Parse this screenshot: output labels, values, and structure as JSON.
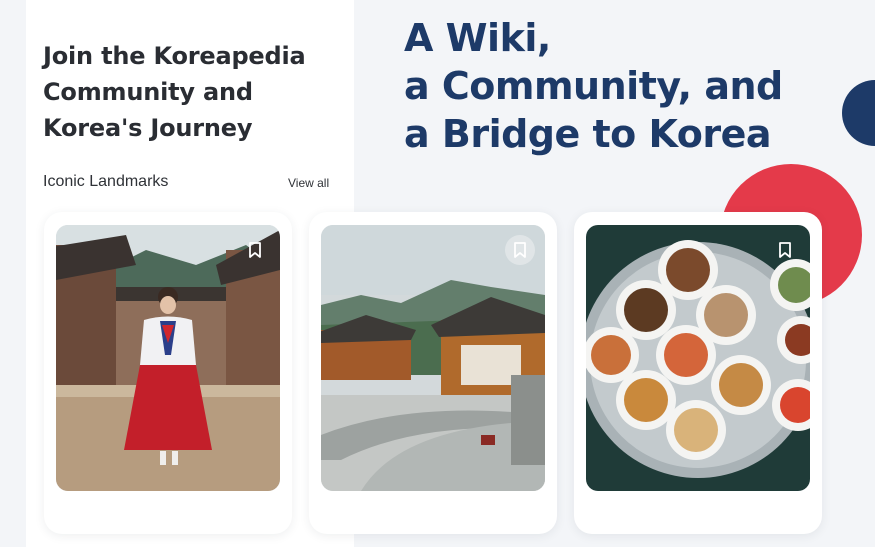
{
  "community": {
    "title": "Join the Koreapedia\nCommunity and\nKorea's Journey"
  },
  "landmarks": {
    "section_title": "Iconic Landmarks",
    "view_all_label": "View all"
  },
  "hero": {
    "headline": "A Wiki,\na Community, and\na Bridge to Korea"
  },
  "cards": [
    {
      "subject": "woman in hanbok at hanok village",
      "bookmark_icon": "bookmark-icon"
    },
    {
      "subject": "traditional hanok village with mountains",
      "bookmark_icon": "bookmark-icon"
    },
    {
      "subject": "korean side dishes on metal tray",
      "bookmark_icon": "bookmark-icon"
    }
  ],
  "colors": {
    "hero_text": "#1d3a68",
    "accent_red": "#e43a4a",
    "accent_navy": "#1d3a68",
    "background": "#f3f5f8"
  }
}
